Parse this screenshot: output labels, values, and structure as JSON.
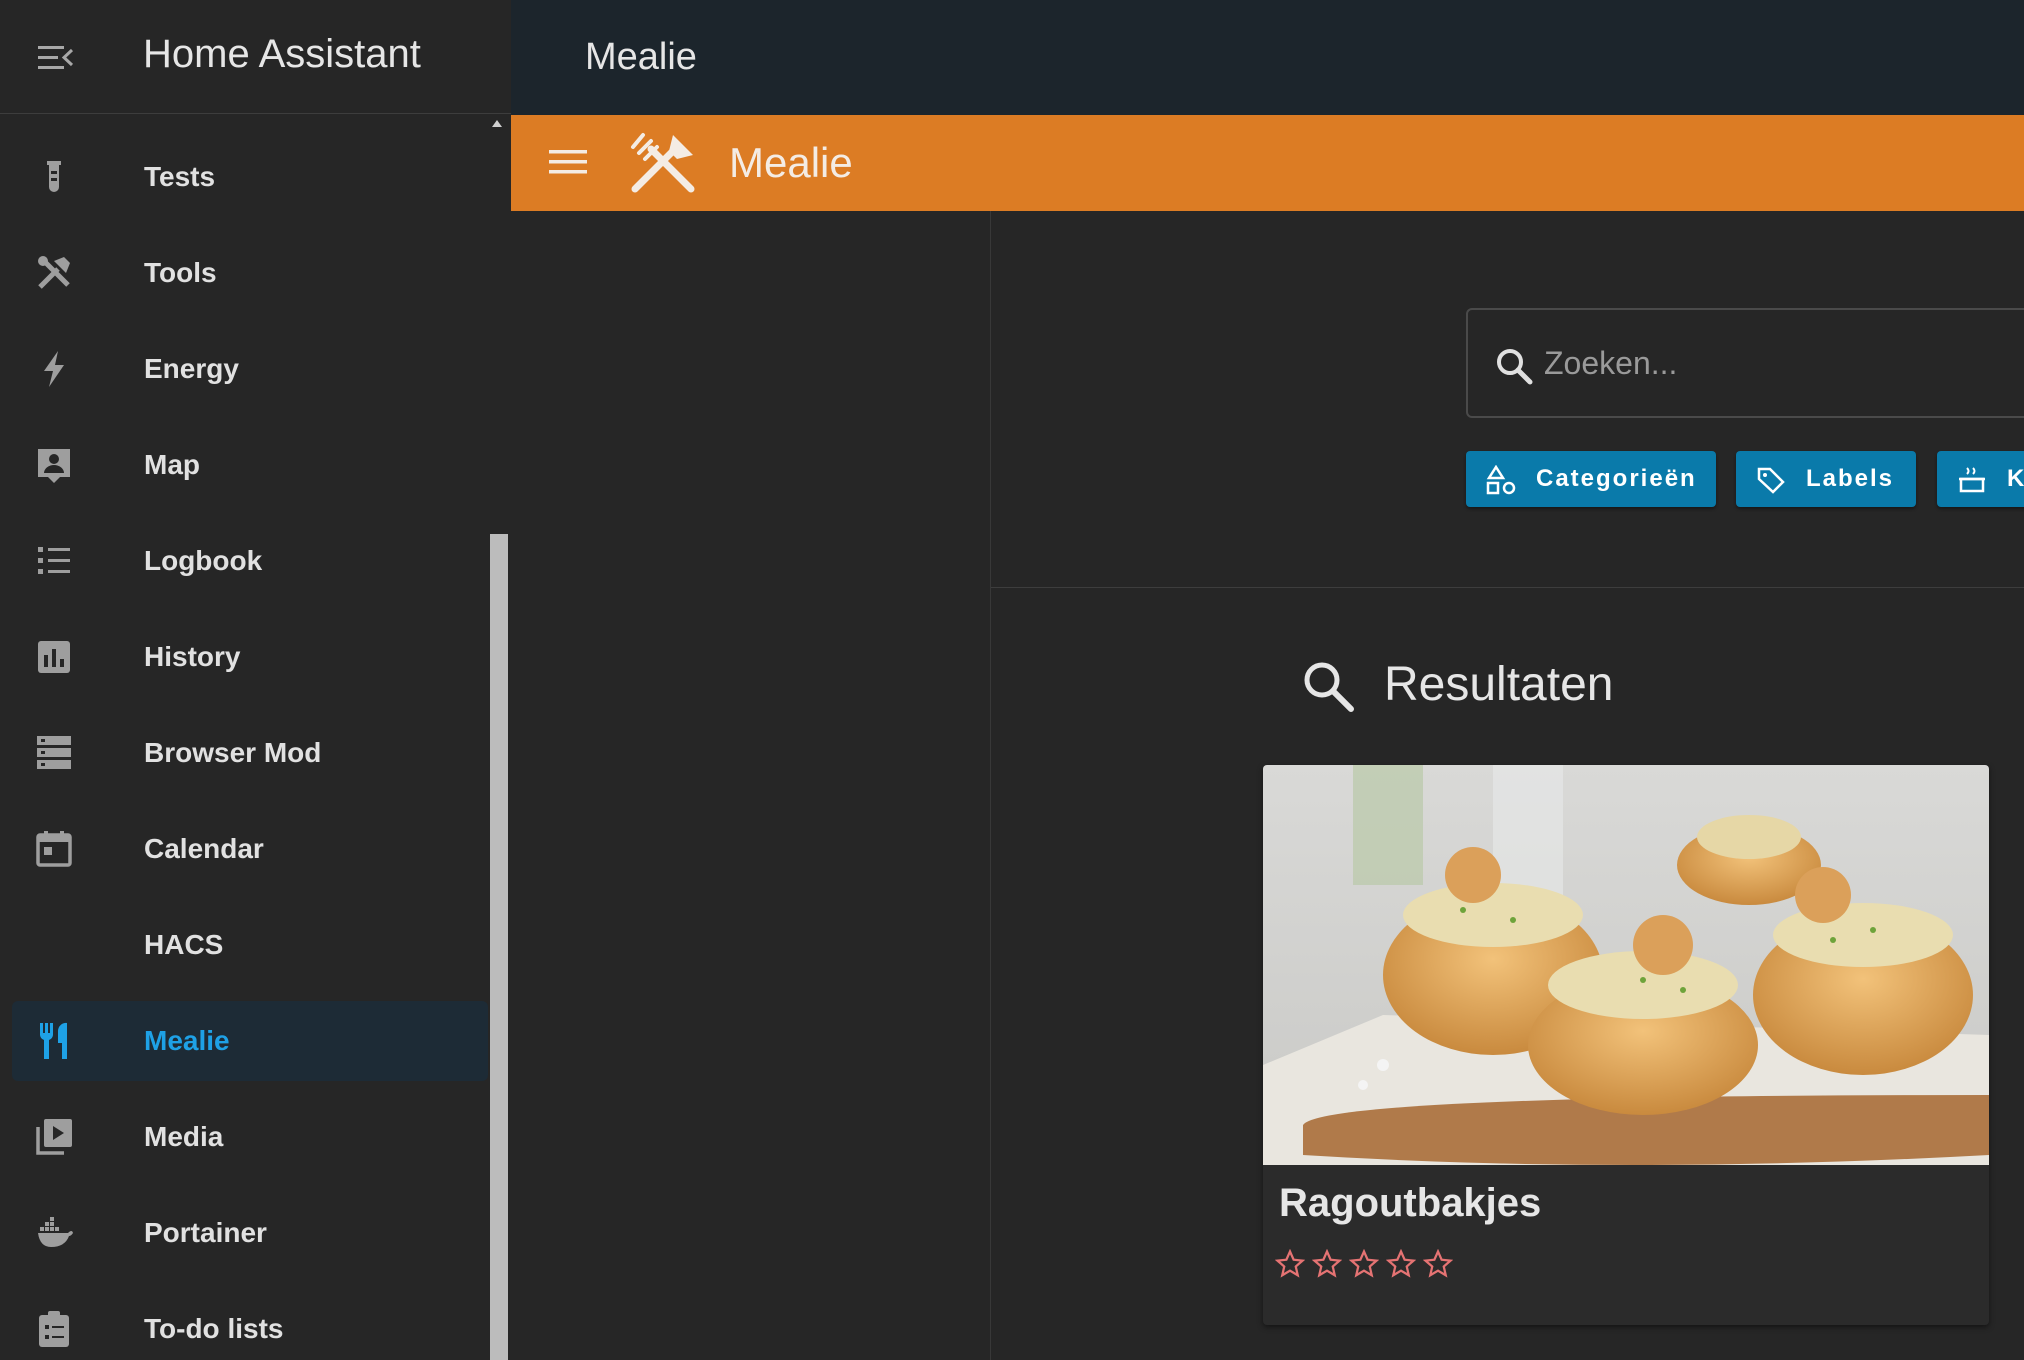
{
  "app": {
    "title": "Home Assistant"
  },
  "sidebar": {
    "items": [
      {
        "label": "Tests",
        "icon": "test-tube-icon",
        "active": false
      },
      {
        "label": "Tools",
        "icon": "tools-icon",
        "active": false
      },
      {
        "label": "Energy",
        "icon": "lightning-bolt-icon",
        "active": false
      },
      {
        "label": "Map",
        "icon": "account-box-icon",
        "active": false
      },
      {
        "label": "Logbook",
        "icon": "format-list-bulleted-icon",
        "active": false
      },
      {
        "label": "History",
        "icon": "chart-box-icon",
        "active": false
      },
      {
        "label": "Browser Mod",
        "icon": "server-icon",
        "active": false
      },
      {
        "label": "Calendar",
        "icon": "calendar-icon",
        "active": false
      },
      {
        "label": "HACS",
        "icon": "",
        "active": false
      },
      {
        "label": "Mealie",
        "icon": "silverware-fork-knife-icon",
        "active": true
      },
      {
        "label": "Media",
        "icon": "play-box-multiple-icon",
        "active": false
      },
      {
        "label": "Portainer",
        "icon": "docker-icon",
        "active": false
      },
      {
        "label": "To-do lists",
        "icon": "clipboard-list-icon",
        "active": false
      }
    ]
  },
  "topbar": {
    "title": "Mealie"
  },
  "mealie": {
    "title": "Mealie",
    "search": {
      "placeholder": "Zoeken...",
      "value": ""
    },
    "filters": [
      {
        "label": "Categorieën",
        "icon": "shapes-icon"
      },
      {
        "label": "Labels",
        "icon": "tag-multiple-icon"
      },
      {
        "label": "K",
        "icon": "pot-steam-icon"
      }
    ],
    "results": {
      "title": "Resultaten"
    },
    "recipes": [
      {
        "name": "Ragoutbakjes",
        "rating": 0,
        "max_rating": 5
      }
    ]
  },
  "colors": {
    "accent": "#1ea1e6",
    "mealie_orange": "#dc7c24",
    "chip_blue": "#0a7aaa",
    "star": "#e57373"
  }
}
